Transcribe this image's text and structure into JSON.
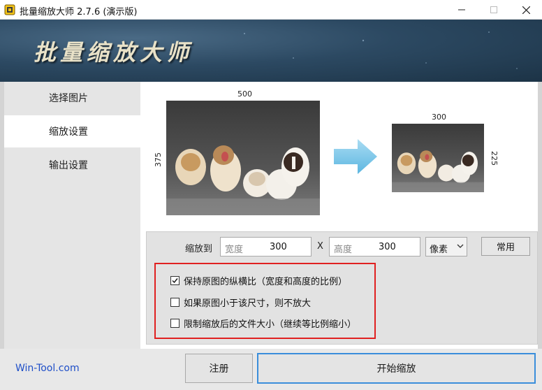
{
  "window": {
    "title": "批量缩放大师 2.7.6 (演示版)"
  },
  "banner": {
    "title": "批量缩放大师"
  },
  "sidebar": {
    "items": [
      {
        "label": "选择图片",
        "active": false
      },
      {
        "label": "缩放设置",
        "active": true
      },
      {
        "label": "输出设置",
        "active": false
      }
    ]
  },
  "preview": {
    "source": {
      "width_label": "500",
      "height_label": "375"
    },
    "target": {
      "width_label": "300",
      "height_label": "225"
    }
  },
  "scale": {
    "label": "缩放到",
    "width_placeholder": "宽度",
    "width_value": "300",
    "separator": "X",
    "height_placeholder": "高度",
    "height_value": "300",
    "unit": "像素",
    "common_button": "常用"
  },
  "options": [
    {
      "label": "保持原图的纵横比（宽度和高度的比例）",
      "checked": true
    },
    {
      "label": "如果原图小于该尺寸，则不放大",
      "checked": false
    },
    {
      "label": "限制缩放后的文件大小（继续等比例缩小）",
      "checked": false
    }
  ],
  "footer": {
    "site": "Win-Tool.com",
    "register_button": "注册",
    "start_button": "开始缩放"
  },
  "colors": {
    "accent": "#3a8edb",
    "highlight_border": "#e02020",
    "banner_dark": "#1c3346",
    "link": "#1f4fc8"
  }
}
